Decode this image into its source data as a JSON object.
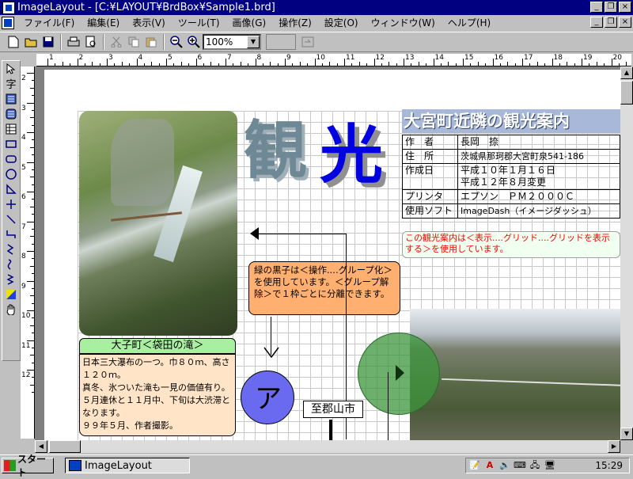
{
  "window": {
    "title": "ImageLayout - [C:¥LAYOUT¥BrdBox¥Sample1.brd]",
    "title_controls": [
      "_",
      "❐",
      "×"
    ],
    "doc_controls": [
      "_",
      "❐",
      "×"
    ]
  },
  "menu": [
    "ファイル(F)",
    "編集(E)",
    "表示(V)",
    "ツール(T)",
    "画像(G)",
    "操作(Z)",
    "設定(O)",
    "ウィンドウ(W)",
    "ヘルプ(H)"
  ],
  "toolbar": {
    "zoom": "100%",
    "icons": [
      "new-icon",
      "open-icon",
      "save-icon",
      "print-icon",
      "print-preview-icon",
      "cut-icon",
      "copy-icon",
      "paste-icon",
      "zoom-out-icon",
      "zoom-in-icon"
    ]
  },
  "palette": [
    "arrow",
    "字",
    "text-h",
    "text-v",
    "table",
    "rect",
    "rounded-rect",
    "circle",
    "triangle",
    "cross",
    "line",
    "elbow",
    "zigzag",
    "curve",
    "spring",
    "color",
    "hand"
  ],
  "ruler": {
    "h_labels": [
      "1",
      "2",
      "3",
      "4",
      "5",
      "6",
      "7",
      "8",
      "9",
      "10",
      "11",
      "12",
      "13",
      "14",
      "15",
      "16",
      "17",
      "18",
      "19",
      "20"
    ],
    "v_labels": [
      "2",
      "3",
      "4",
      "5",
      "6",
      "7",
      "8",
      "9",
      "10",
      "11",
      "12"
    ]
  },
  "content": {
    "heading_1": "観",
    "heading_2": "光",
    "info_title": "大宮町近隣の観光案内",
    "info_rows": [
      {
        "key": "作　者",
        "value": "長岡　捺"
      },
      {
        "key": "住　所",
        "value": "茨城県那珂郡大宮町泉541-186"
      },
      {
        "key": "作成日",
        "value": "平成１０年１月１６日\n平成１２年８月変更"
      },
      {
        "key": "プリンタ",
        "value": "エプソン　ＰＭ２０００Ｃ"
      },
      {
        "key": "使用ソフト",
        "value": "ImageDash（イメージダッシュ）"
      }
    ],
    "note": "この観光案内は＜表示....グリッド....グリッドを表示する＞を使用しています。",
    "bubble": "緑の黒子は＜操作....グループ化＞を使用しています。＜グループ解除＞で１枠ごとに分離できます。",
    "caption": "大子町＜袋田の滝＞",
    "description": "日本三大瀑布の一つ。巾８０ｍ、高さ１２０ｍ。\n真冬、氷ついた滝も一見の価値有り。\n５月連休と１１月中、下旬は大渋滞となります。\n９９年５月、作者撮影。",
    "circle_char": "ア",
    "sign": "至郡山市"
  },
  "taskbar": {
    "start": "スタート",
    "task": "ImageLayout",
    "clock": "15:29"
  }
}
